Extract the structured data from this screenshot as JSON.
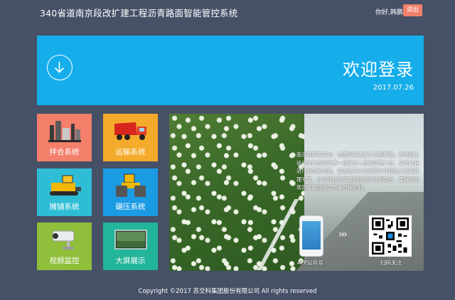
{
  "header": {
    "title": "340省道南京段改扩建工程沥青路面智能管控系统",
    "greeting": "你好,韩鹏",
    "logout_label": "退出"
  },
  "banner": {
    "icon": "download-circle-icon",
    "title": "欢迎登录",
    "date": "2017.07.26"
  },
  "tiles": [
    {
      "label": "拌合系统",
      "icon": "asphalt-plant-icon",
      "color": "#f47f6a"
    },
    {
      "label": "运输系统",
      "icon": "dump-truck-icon",
      "color": "#f4aa2a"
    },
    {
      "label": "摊铺系统",
      "icon": "paver-icon",
      "color": "#2fbdd6"
    },
    {
      "label": "碾压系统",
      "icon": "road-roller-icon",
      "color": "#1a9be3"
    },
    {
      "label": "视频监控",
      "icon": "cctv-camera-icon",
      "color": "#8fbf3b"
    },
    {
      "label": "大屏展示",
      "icon": "big-screen-icon",
      "color": "#23b59a"
    }
  ],
  "photo": {
    "caption": "南京院研发实时、全面的采集施工过程数据，并将施工状况及时告知现场一线操作人员和管理人员，实时对其进行指导和调整。该系统可以有效弥补传统施工质量管理不足，并与传统沥青路面控制方法相结合，更好的实现沥青路面施工质量过程控制。",
    "app_label": "APP公众号",
    "scan_label": "扫码关注"
  },
  "footer": {
    "copyright": "Copyright ©2017 苏交科集团股份有限公司 All rights reserved"
  },
  "colors": {
    "background": "#465066",
    "banner": "#16adeb",
    "logout": "#f0806b"
  }
}
